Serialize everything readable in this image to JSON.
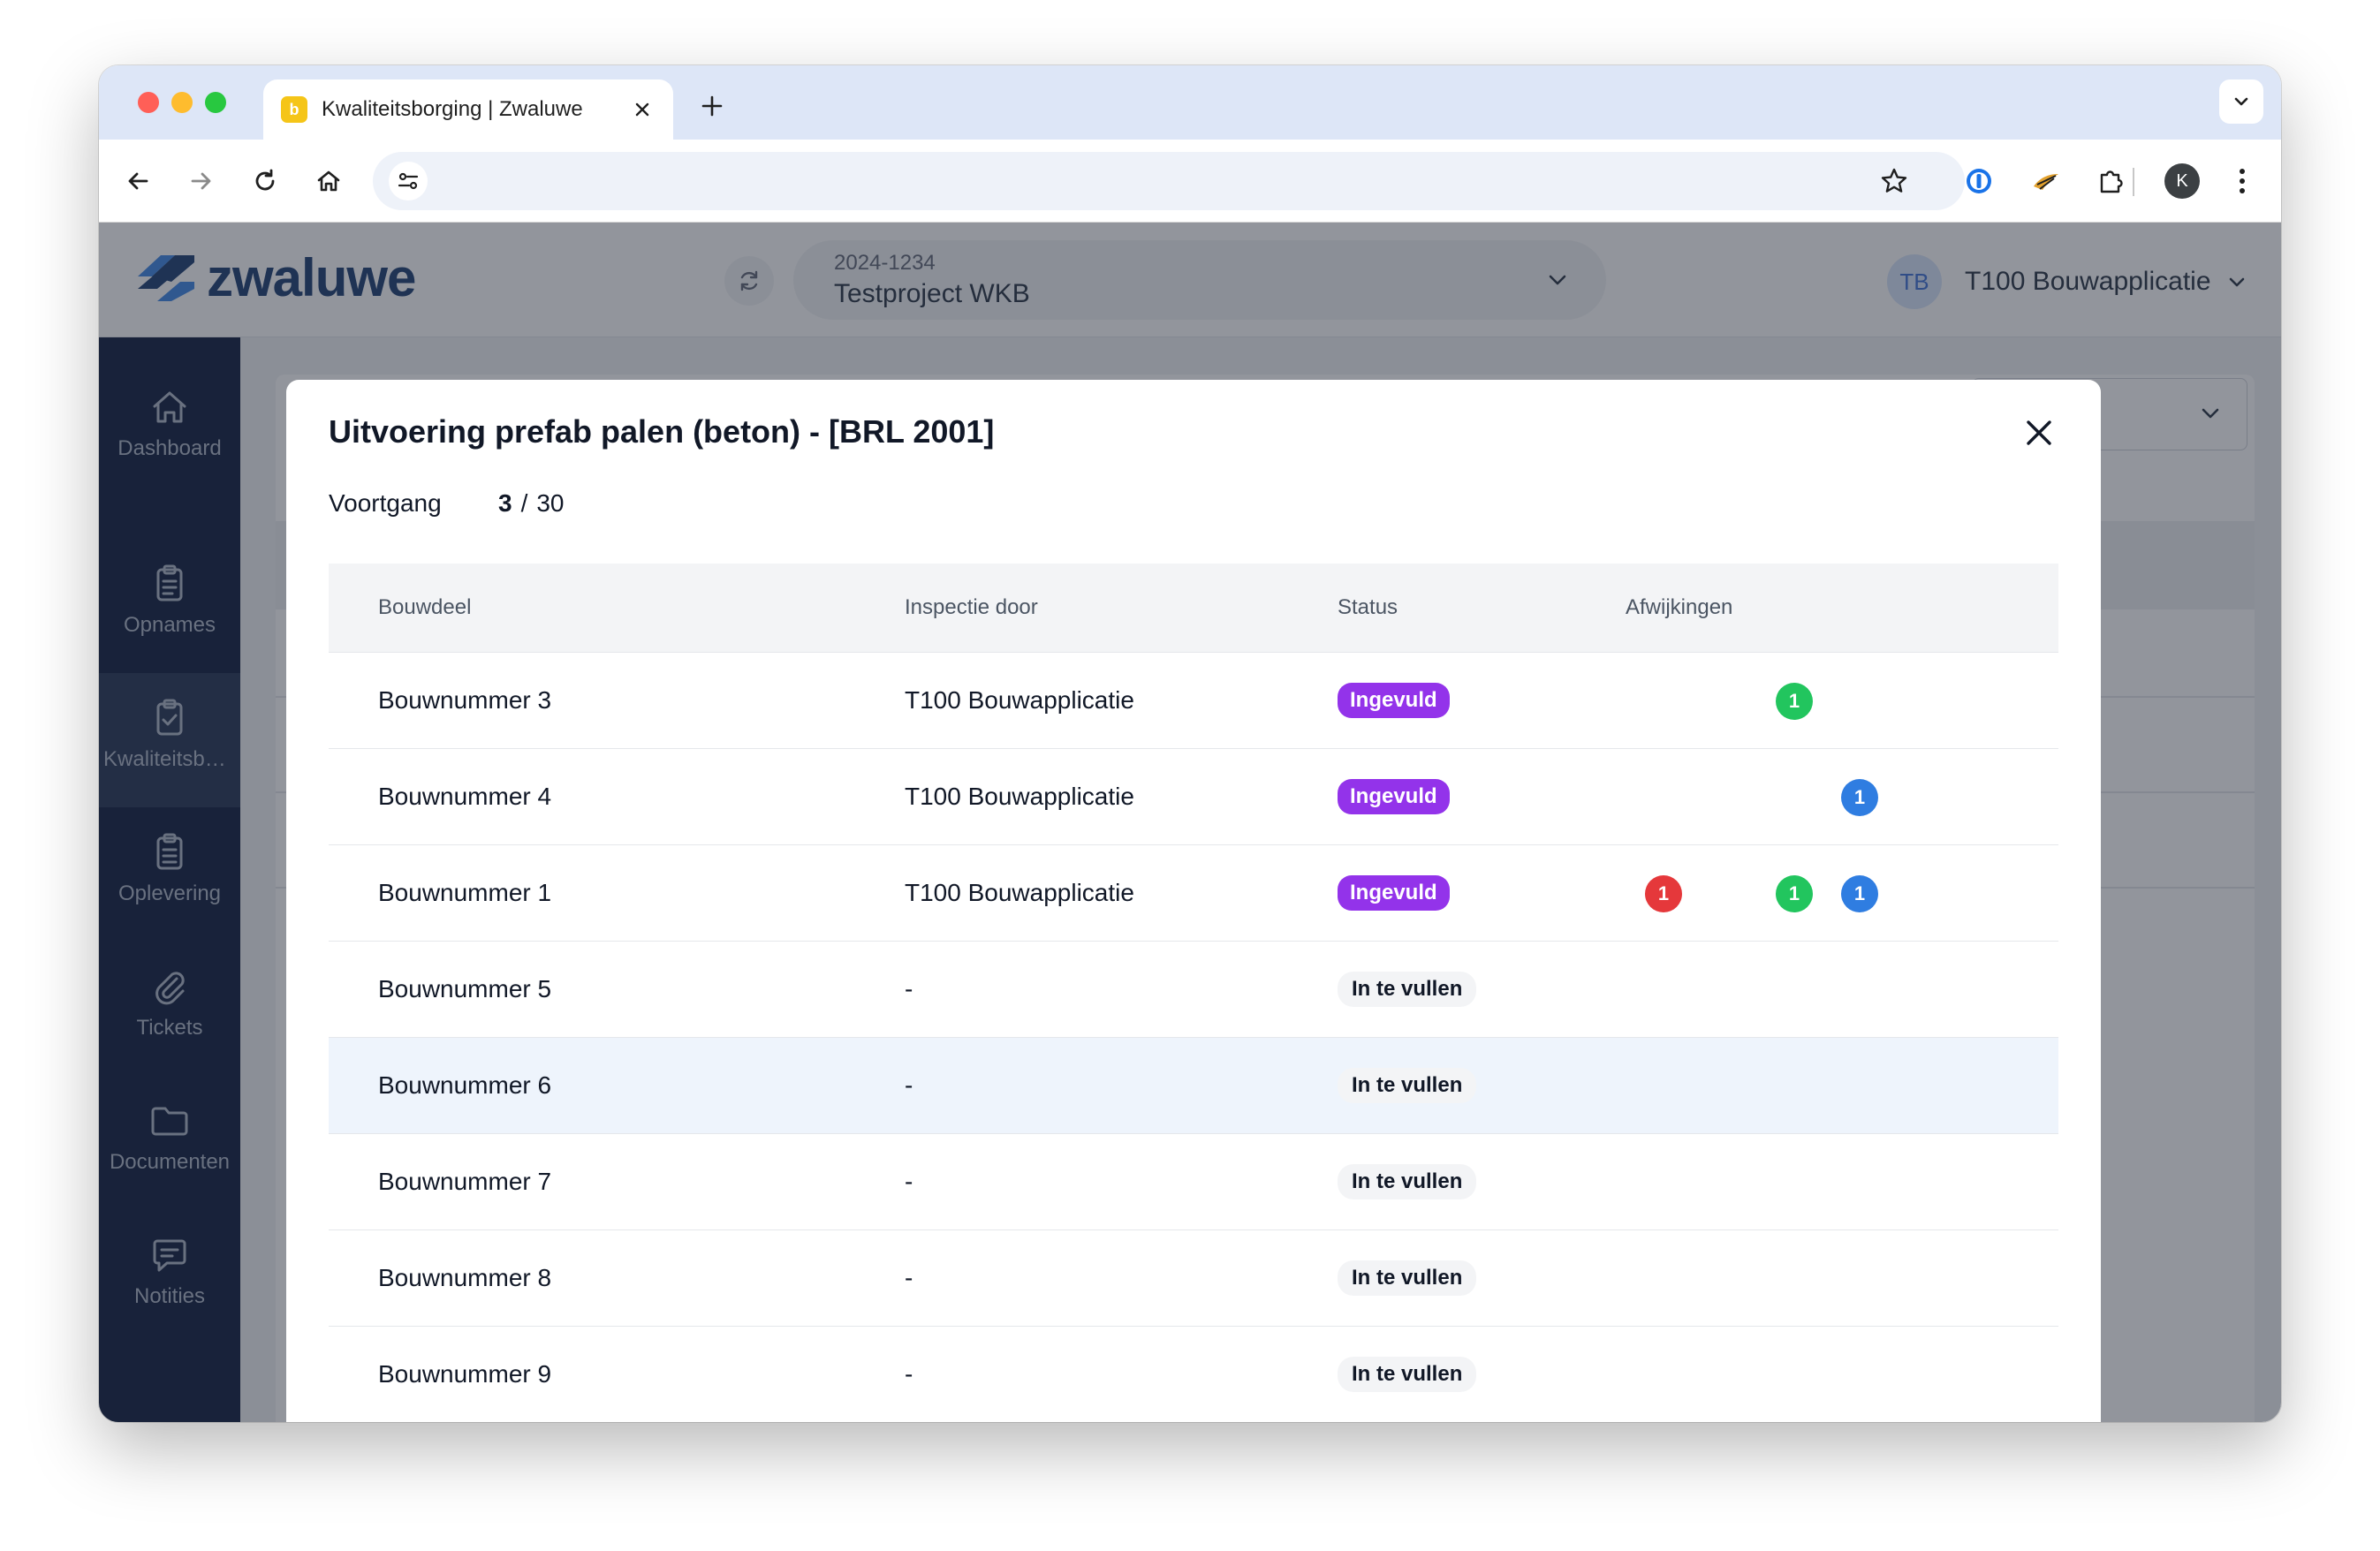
{
  "browser": {
    "tab_title": "Kwaliteitsborging | Zwaluwe",
    "address_url": ""
  },
  "header": {
    "brand": "zwaluwe",
    "project_code": "2024-1234",
    "project_name": "Testproject WKB",
    "user_initials": "TB",
    "user_name": "T100 Bouwapplicatie"
  },
  "sidebar": {
    "items": [
      {
        "label": "Dashboard",
        "icon": "home-icon"
      },
      {
        "label": "Opnames",
        "icon": "clipboard-icon"
      },
      {
        "label": "Kwaliteitsborging",
        "icon": "clipboard-check-icon"
      },
      {
        "label": "Oplevering",
        "icon": "clipboard-list-icon"
      },
      {
        "label": "Tickets",
        "icon": "paperclip-icon"
      },
      {
        "label": "Documenten",
        "icon": "folder-icon"
      },
      {
        "label": "Notities",
        "icon": "chat-icon"
      }
    ]
  },
  "modal": {
    "title": "Uitvoering prefab palen (beton) - [BRL 2001]",
    "progress_label": "Voortgang",
    "progress_done": "3",
    "progress_separator": "/",
    "progress_total": "30",
    "columns": [
      "Bouwdeel",
      "Inspectie door",
      "Status",
      "Afwijkingen"
    ],
    "rows": [
      {
        "bouwdeel": "Bouwnummer 3",
        "inspectie": "T100 Bouwapplicatie",
        "status": "Ingevuld",
        "status_kind": "filled",
        "afwijkingen": [
          {
            "color": "#22c55e",
            "count": "1",
            "slot": 1
          }
        ]
      },
      {
        "bouwdeel": "Bouwnummer 4",
        "inspectie": "T100 Bouwapplicatie",
        "status": "Ingevuld",
        "status_kind": "filled",
        "afwijkingen": [
          {
            "color": "#2f7de1",
            "count": "1",
            "slot": 2
          }
        ]
      },
      {
        "bouwdeel": "Bouwnummer 1",
        "inspectie": "T100 Bouwapplicatie",
        "status": "Ingevuld",
        "status_kind": "filled",
        "afwijkingen": [
          {
            "color": "#e5383b",
            "count": "1",
            "slot": 0
          },
          {
            "color": "#22c55e",
            "count": "1",
            "slot": 1
          },
          {
            "color": "#2f7de1",
            "count": "1",
            "slot": 2
          }
        ]
      },
      {
        "bouwdeel": "Bouwnummer 5",
        "inspectie": "-",
        "status": "In te vullen",
        "status_kind": "todo",
        "afwijkingen": []
      },
      {
        "bouwdeel": "Bouwnummer 6",
        "inspectie": "-",
        "status": "In te vullen",
        "status_kind": "todo",
        "afwijkingen": [],
        "highlighted": true
      },
      {
        "bouwdeel": "Bouwnummer 7",
        "inspectie": "-",
        "status": "In te vullen",
        "status_kind": "todo",
        "afwijkingen": []
      },
      {
        "bouwdeel": "Bouwnummer 8",
        "inspectie": "-",
        "status": "In te vullen",
        "status_kind": "todo",
        "afwijkingen": []
      },
      {
        "bouwdeel": "Bouwnummer 9",
        "inspectie": "-",
        "status": "In te vullen",
        "status_kind": "todo",
        "afwijkingen": []
      }
    ]
  },
  "colors": {
    "status_filled": "#9333ea",
    "deviation_red": "#e5383b",
    "deviation_green": "#22c55e",
    "deviation_blue": "#2f7de1",
    "sidebar_bg": "#1f2c4a",
    "brand": "#2b4a7a"
  }
}
